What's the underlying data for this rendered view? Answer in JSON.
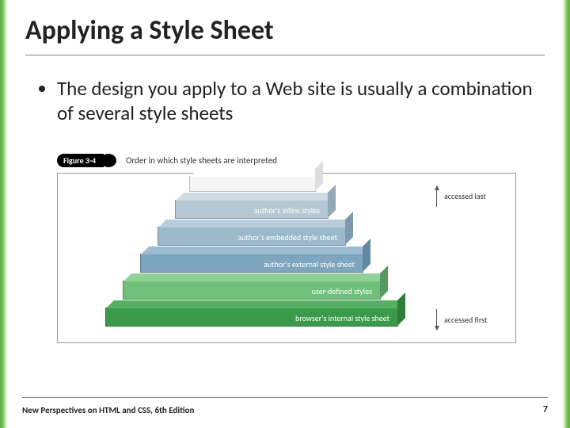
{
  "title": "Applying a Style Sheet",
  "bullet": "The design you apply to a Web site is usually a combination of several style sheets",
  "figure": {
    "label": "Figure 3-4",
    "caption": "Order in which style sheets are interpreted",
    "layers": {
      "l1": "author's inline styles",
      "l2": "author's embedded style sheet",
      "l3": "author's external style sheet",
      "l4": "user-defined styles",
      "l5": "browser's internal style sheet"
    },
    "accessed_last": "accessed last",
    "accessed_first": "accessed first"
  },
  "footer": {
    "left": "New Perspectives on HTML and CSS, 6th Edition",
    "page": "7"
  }
}
